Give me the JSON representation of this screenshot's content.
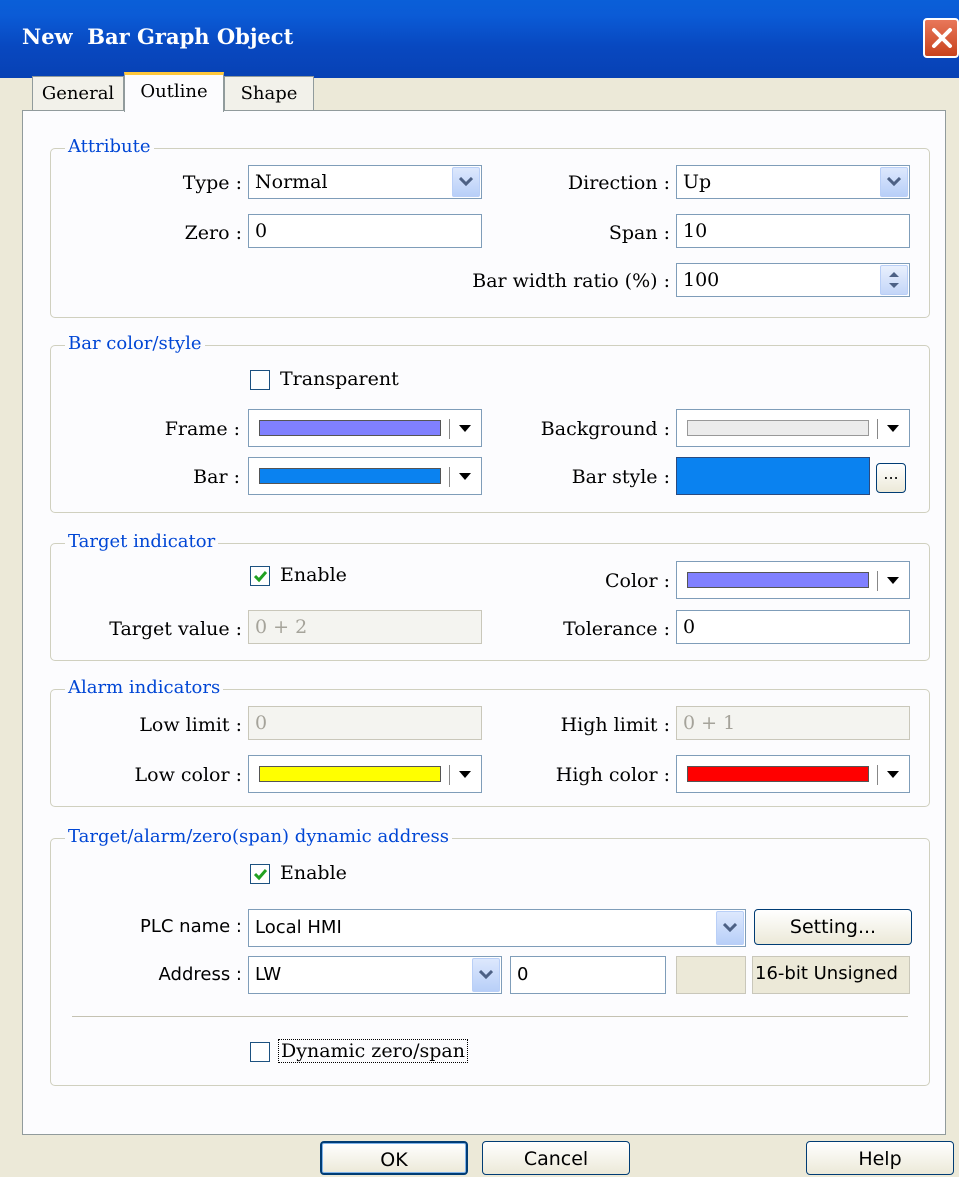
{
  "window": {
    "title": "New  Bar Graph Object"
  },
  "tabs": [
    {
      "label": "General"
    },
    {
      "label": "Outline"
    },
    {
      "label": "Shape"
    }
  ],
  "attribute": {
    "group_label": "Attribute",
    "type_label": "Type :",
    "type_value": "Normal",
    "direction_label": "Direction :",
    "direction_value": "Up",
    "zero_label": "Zero :",
    "zero_value": "0",
    "span_label": "Span :",
    "span_value": "10",
    "bar_width_label": "Bar width ratio (%) :",
    "bar_width_value": "100"
  },
  "bar_color_style": {
    "group_label": "Bar color/style",
    "transparent_label": "Transparent",
    "transparent_checked": false,
    "frame_label": "Frame :",
    "frame_color": "#8080ff",
    "background_label": "Background :",
    "background_color": "#ececec",
    "bar_label": "Bar :",
    "bar_color": "#0a82f0",
    "bar_style_label": "Bar style :",
    "bar_style_color": "#0a82f0",
    "bar_style_button": "..."
  },
  "target_indicator": {
    "group_label": "Target indicator",
    "enable_label": "Enable",
    "enable_checked": true,
    "color_label": "Color :",
    "color": "#8080ff",
    "target_value_label": "Target value :",
    "target_value": "0 + 2",
    "tolerance_label": "Tolerance :",
    "tolerance_value": "0"
  },
  "alarm_indicators": {
    "group_label": "Alarm indicators",
    "low_limit_label": "Low limit :",
    "low_limit_value": "0",
    "high_limit_label": "High limit :",
    "high_limit_value": "0 + 1",
    "low_color_label": "Low color :",
    "low_color": "#ffff00",
    "high_color_label": "High color :",
    "high_color": "#ff0000"
  },
  "dynamic_address": {
    "group_label": "Target/alarm/zero(span) dynamic address",
    "enable_label": "Enable",
    "enable_checked": true,
    "plc_name_label": "PLC name :",
    "plc_name_value": "Local HMI",
    "setting_button": "Setting...",
    "address_label": "Address :",
    "address_device": "LW",
    "address_value": "0",
    "data_format": "16-bit Unsigned",
    "dynamic_zero_span_label": "Dynamic zero/span",
    "dynamic_zero_span_checked": false
  },
  "footer": {
    "ok_button": "OK",
    "cancel_button": "Cancel",
    "help_button": "Help"
  }
}
